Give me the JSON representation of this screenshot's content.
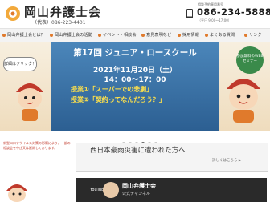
{
  "header": {
    "site_title": "岡山弁護士会",
    "rep_label": "（代表）",
    "rep_tel": "086-223-4401",
    "res_label": "相談予約専用番号",
    "res_tel": "086-234-5888",
    "hours": "（平日 9:00〜17:00）"
  },
  "nav": {
    "items": [
      "岡山弁護士会とは？",
      "岡山弁護士会の活動",
      "イベント・相談会",
      "意見表明など",
      "採用情報",
      "よくある質問",
      "リンク"
    ]
  },
  "hero": {
    "bubble": "詳細はクリック！",
    "badge": "参加無料のWEBセミナー",
    "event_title": "第17回 ジュニア・ロースクール",
    "event_date": "2021年11月20日（土）",
    "event_time": "14：00〜17：00",
    "class1": "授業①「スーパーでの悲劇」",
    "class2": "授業②「契約ってなんだろう？」"
  },
  "slider": {
    "count": 6,
    "active": 3
  },
  "notice": "新型コロナウイルス対策の影響により、一部の相談会を中止又は延期しております。",
  "disaster": {
    "text": "西日本豪雨災害に遭われた方へ",
    "more": "詳しくはこちら ▶"
  },
  "youtube": {
    "label": "YouTube",
    "title": "岡山弁護士会",
    "subtitle": "公式チャンネル"
  },
  "colors": {
    "accent": "#e07a2c",
    "banner_blue": "#2c5f92",
    "class_yellow": "#ffe14a"
  }
}
